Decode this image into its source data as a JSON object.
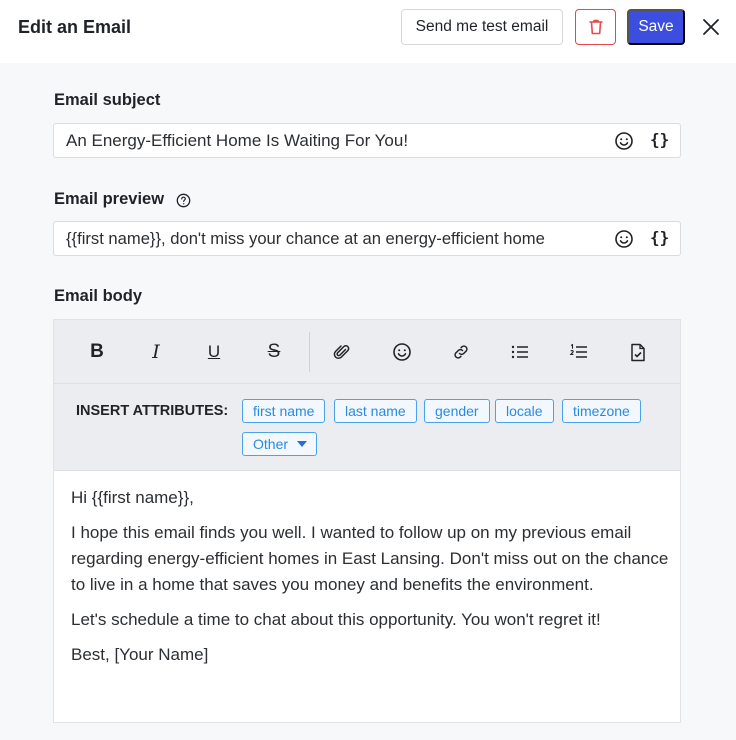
{
  "header": {
    "title": "Edit an Email",
    "test_button": "Send me test email",
    "delete_icon": "trash-icon",
    "save_button": "Save",
    "close_icon": "close-icon"
  },
  "subject": {
    "label": "Email subject",
    "value": "An Energy-Efficient Home Is Waiting For You!",
    "emoji_icon": "emoji-icon",
    "variables": "{}"
  },
  "preview": {
    "label": "Email preview",
    "help_icon": "help-circle-icon",
    "value": "{{first name}}, don't miss your chance at an energy-efficient home",
    "emoji_icon": "emoji-icon",
    "variables": "{}"
  },
  "body": {
    "label": "Email body",
    "toolbar": {
      "bold": "B",
      "italic": "I",
      "underline": "U",
      "strikethrough": "S",
      "icons": [
        "bold-icon",
        "italic-icon",
        "underline-icon",
        "strikethrough-icon",
        "attachment-icon",
        "emoji-icon",
        "link-icon",
        "bullet-list-icon",
        "numbered-list-icon",
        "document-icon"
      ]
    },
    "insert_attributes": {
      "label": "INSERT ATTRIBUTES:",
      "chips": [
        "first name",
        "last name",
        "gender",
        "locale",
        "timezone"
      ],
      "other": "Other"
    },
    "paragraphs": [
      "Hi {{first name}},",
      "I hope this email finds you well. I wanted to follow up on my previous email regarding energy-efficient homes in East Lansing. Don't miss out on the chance to live in a home that saves you money and benefits the environment.",
      "Let's schedule a time to chat about this opportunity. You won't regret it!",
      "Best, [Your Name]"
    ]
  },
  "colors": {
    "primary": "#3b4ee0",
    "danger": "#e5484d",
    "chip": "#2b8ae0"
  }
}
